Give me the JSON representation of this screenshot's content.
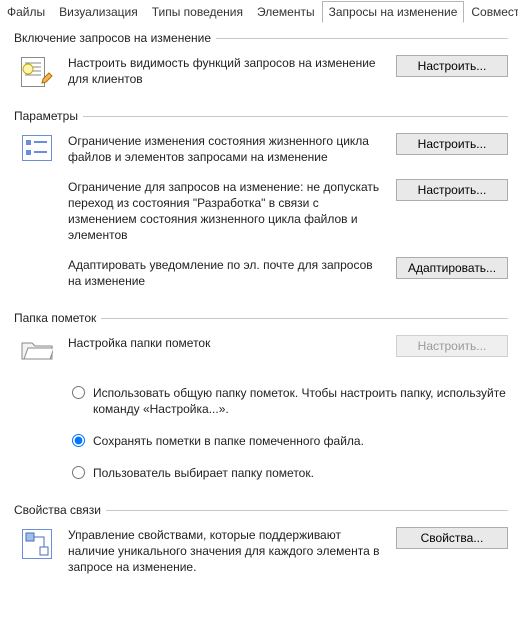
{
  "tabs": {
    "items": [
      "Файлы",
      "Визуализация",
      "Типы поведения",
      "Элементы",
      "Запросы на изменение",
      "Совмест"
    ],
    "active_index": 4
  },
  "groups": {
    "enable": {
      "legend": "Включение запросов на изменение",
      "rows": [
        {
          "text": "Настроить видимость функций запросов на изменение для клиентов",
          "button": "Настроить..."
        }
      ]
    },
    "params": {
      "legend": "Параметры",
      "rows": [
        {
          "text": "Ограничение изменения состояния жизненного цикла файлов и элементов запросами на изменение",
          "button": "Настроить..."
        },
        {
          "text": "Ограничение для запросов на изменение: не допускать переход из состояния \"Разработка\" в связи с изменением состояния жизненного цикла файлов и элементов",
          "button": "Настроить..."
        },
        {
          "text": "Адаптировать уведомление по эл. почте для запросов на изменение",
          "button": "Адаптировать..."
        }
      ]
    },
    "folder": {
      "legend": "Папка пометок",
      "heading": "Настройка папки пометок",
      "button": "Настроить...",
      "button_enabled": false,
      "options": [
        {
          "value": "shared",
          "label": "Использовать общую папку пометок. Чтобы настроить папку, используйте команду «Настройка...»."
        },
        {
          "value": "file",
          "label": "Сохранять пометки в папке помеченного файла."
        },
        {
          "value": "user",
          "label": "Пользователь выбирает папку пометок."
        }
      ],
      "selected": "file"
    },
    "link": {
      "legend": "Свойства связи",
      "rows": [
        {
          "text": "Управление свойствами, которые поддерживают наличие уникального значения для каждого элемента в запросе на изменение.",
          "button": "Свойства..."
        }
      ]
    }
  }
}
